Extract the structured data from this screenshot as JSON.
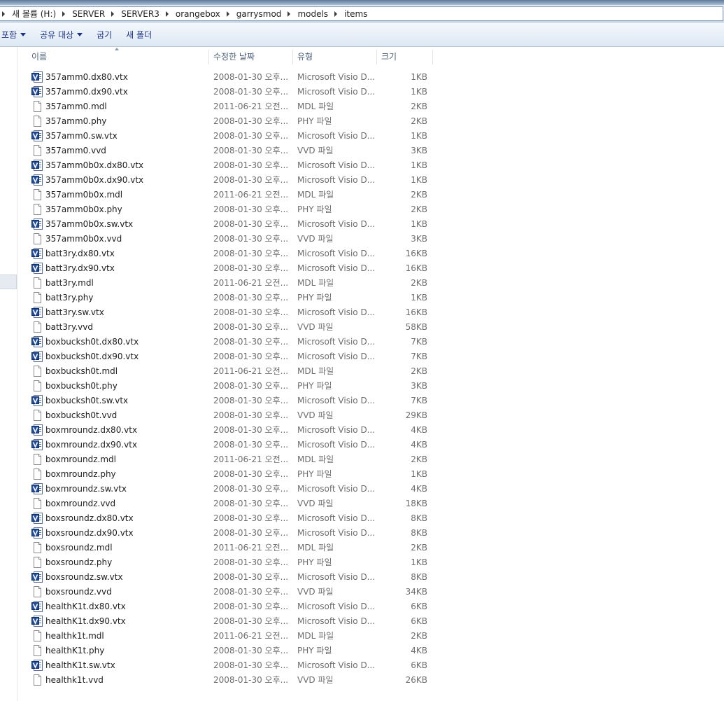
{
  "address_bar": {
    "crumbs": [
      "새 볼륨 (H:)",
      "SERVER",
      "SERVER3",
      "orangebox",
      "garrysmod",
      "models",
      "items"
    ]
  },
  "toolbar": {
    "include_label": "포함",
    "share_label": "공유 대상",
    "burn_label": "굽기",
    "new_folder_label": "새 폴더"
  },
  "columns": {
    "name": "이름",
    "date": "수정한 날짜",
    "type": "유형",
    "size": "크기"
  },
  "icons": {
    "vtx": "visio-file-icon",
    "generic": "blank-file-icon"
  },
  "files": [
    {
      "name": "357amm0.dx80.vtx",
      "date": "2008-01-30 오후...",
      "type": "Microsoft Visio D...",
      "size": "1KB",
      "icon": "vtx"
    },
    {
      "name": "357amm0.dx90.vtx",
      "date": "2008-01-30 오후...",
      "type": "Microsoft Visio D...",
      "size": "1KB",
      "icon": "vtx"
    },
    {
      "name": "357amm0.mdl",
      "date": "2011-06-21 오전...",
      "type": "MDL 파일",
      "size": "2KB",
      "icon": "generic"
    },
    {
      "name": "357amm0.phy",
      "date": "2008-01-30 오후...",
      "type": "PHY 파일",
      "size": "2KB",
      "icon": "generic"
    },
    {
      "name": "357amm0.sw.vtx",
      "date": "2008-01-30 오후...",
      "type": "Microsoft Visio D...",
      "size": "1KB",
      "icon": "vtx"
    },
    {
      "name": "357amm0.vvd",
      "date": "2008-01-30 오후...",
      "type": "VVD 파일",
      "size": "3KB",
      "icon": "generic"
    },
    {
      "name": "357amm0b0x.dx80.vtx",
      "date": "2008-01-30 오후...",
      "type": "Microsoft Visio D...",
      "size": "1KB",
      "icon": "vtx"
    },
    {
      "name": "357amm0b0x.dx90.vtx",
      "date": "2008-01-30 오후...",
      "type": "Microsoft Visio D...",
      "size": "1KB",
      "icon": "vtx"
    },
    {
      "name": "357amm0b0x.mdl",
      "date": "2011-06-21 오전...",
      "type": "MDL 파일",
      "size": "2KB",
      "icon": "generic"
    },
    {
      "name": "357amm0b0x.phy",
      "date": "2008-01-30 오후...",
      "type": "PHY 파일",
      "size": "2KB",
      "icon": "generic"
    },
    {
      "name": "357amm0b0x.sw.vtx",
      "date": "2008-01-30 오후...",
      "type": "Microsoft Visio D...",
      "size": "1KB",
      "icon": "vtx"
    },
    {
      "name": "357amm0b0x.vvd",
      "date": "2008-01-30 오후...",
      "type": "VVD 파일",
      "size": "3KB",
      "icon": "generic"
    },
    {
      "name": "batt3ry.dx80.vtx",
      "date": "2008-01-30 오후...",
      "type": "Microsoft Visio D...",
      "size": "16KB",
      "icon": "vtx"
    },
    {
      "name": "batt3ry.dx90.vtx",
      "date": "2008-01-30 오후...",
      "type": "Microsoft Visio D...",
      "size": "16KB",
      "icon": "vtx"
    },
    {
      "name": "batt3ry.mdl",
      "date": "2011-06-21 오전...",
      "type": "MDL 파일",
      "size": "2KB",
      "icon": "generic"
    },
    {
      "name": "batt3ry.phy",
      "date": "2008-01-30 오후...",
      "type": "PHY 파일",
      "size": "1KB",
      "icon": "generic"
    },
    {
      "name": "batt3ry.sw.vtx",
      "date": "2008-01-30 오후...",
      "type": "Microsoft Visio D...",
      "size": "16KB",
      "icon": "vtx"
    },
    {
      "name": "batt3ry.vvd",
      "date": "2008-01-30 오후...",
      "type": "VVD 파일",
      "size": "58KB",
      "icon": "generic"
    },
    {
      "name": "boxbucksh0t.dx80.vtx",
      "date": "2008-01-30 오후...",
      "type": "Microsoft Visio D...",
      "size": "7KB",
      "icon": "vtx"
    },
    {
      "name": "boxbucksh0t.dx90.vtx",
      "date": "2008-01-30 오후...",
      "type": "Microsoft Visio D...",
      "size": "7KB",
      "icon": "vtx"
    },
    {
      "name": "boxbucksh0t.mdl",
      "date": "2011-06-21 오전...",
      "type": "MDL 파일",
      "size": "2KB",
      "icon": "generic"
    },
    {
      "name": "boxbucksh0t.phy",
      "date": "2008-01-30 오후...",
      "type": "PHY 파일",
      "size": "3KB",
      "icon": "generic"
    },
    {
      "name": "boxbucksh0t.sw.vtx",
      "date": "2008-01-30 오후...",
      "type": "Microsoft Visio D...",
      "size": "7KB",
      "icon": "vtx"
    },
    {
      "name": "boxbucksh0t.vvd",
      "date": "2008-01-30 오후...",
      "type": "VVD 파일",
      "size": "29KB",
      "icon": "generic"
    },
    {
      "name": "boxmroundz.dx80.vtx",
      "date": "2008-01-30 오후...",
      "type": "Microsoft Visio D...",
      "size": "4KB",
      "icon": "vtx"
    },
    {
      "name": "boxmroundz.dx90.vtx",
      "date": "2008-01-30 오후...",
      "type": "Microsoft Visio D...",
      "size": "4KB",
      "icon": "vtx"
    },
    {
      "name": "boxmroundz.mdl",
      "date": "2011-06-21 오전...",
      "type": "MDL 파일",
      "size": "2KB",
      "icon": "generic"
    },
    {
      "name": "boxmroundz.phy",
      "date": "2008-01-30 오후...",
      "type": "PHY 파일",
      "size": "1KB",
      "icon": "generic"
    },
    {
      "name": "boxmroundz.sw.vtx",
      "date": "2008-01-30 오후...",
      "type": "Microsoft Visio D...",
      "size": "4KB",
      "icon": "vtx"
    },
    {
      "name": "boxmroundz.vvd",
      "date": "2008-01-30 오후...",
      "type": "VVD 파일",
      "size": "18KB",
      "icon": "generic"
    },
    {
      "name": "boxsroundz.dx80.vtx",
      "date": "2008-01-30 오후...",
      "type": "Microsoft Visio D...",
      "size": "8KB",
      "icon": "vtx"
    },
    {
      "name": "boxsroundz.dx90.vtx",
      "date": "2008-01-30 오후...",
      "type": "Microsoft Visio D...",
      "size": "8KB",
      "icon": "vtx"
    },
    {
      "name": "boxsroundz.mdl",
      "date": "2011-06-21 오전...",
      "type": "MDL 파일",
      "size": "2KB",
      "icon": "generic"
    },
    {
      "name": "boxsroundz.phy",
      "date": "2008-01-30 오후...",
      "type": "PHY 파일",
      "size": "1KB",
      "icon": "generic"
    },
    {
      "name": "boxsroundz.sw.vtx",
      "date": "2008-01-30 오후...",
      "type": "Microsoft Visio D...",
      "size": "8KB",
      "icon": "vtx"
    },
    {
      "name": "boxsroundz.vvd",
      "date": "2008-01-30 오후...",
      "type": "VVD 파일",
      "size": "34KB",
      "icon": "generic"
    },
    {
      "name": "healthK1t.dx80.vtx",
      "date": "2008-01-30 오후...",
      "type": "Microsoft Visio D...",
      "size": "6KB",
      "icon": "vtx"
    },
    {
      "name": "healthK1t.dx90.vtx",
      "date": "2008-01-30 오후...",
      "type": "Microsoft Visio D...",
      "size": "6KB",
      "icon": "vtx"
    },
    {
      "name": "healthk1t.mdl",
      "date": "2011-06-21 오전...",
      "type": "MDL 파일",
      "size": "2KB",
      "icon": "generic"
    },
    {
      "name": "healthK1t.phy",
      "date": "2008-01-30 오후...",
      "type": "PHY 파일",
      "size": "4KB",
      "icon": "generic"
    },
    {
      "name": "healthK1t.sw.vtx",
      "date": "2008-01-30 오후...",
      "type": "Microsoft Visio D...",
      "size": "6KB",
      "icon": "vtx"
    },
    {
      "name": "healthk1t.vvd",
      "date": "2008-01-30 오후...",
      "type": "VVD 파일",
      "size": "26KB",
      "icon": "generic"
    }
  ]
}
